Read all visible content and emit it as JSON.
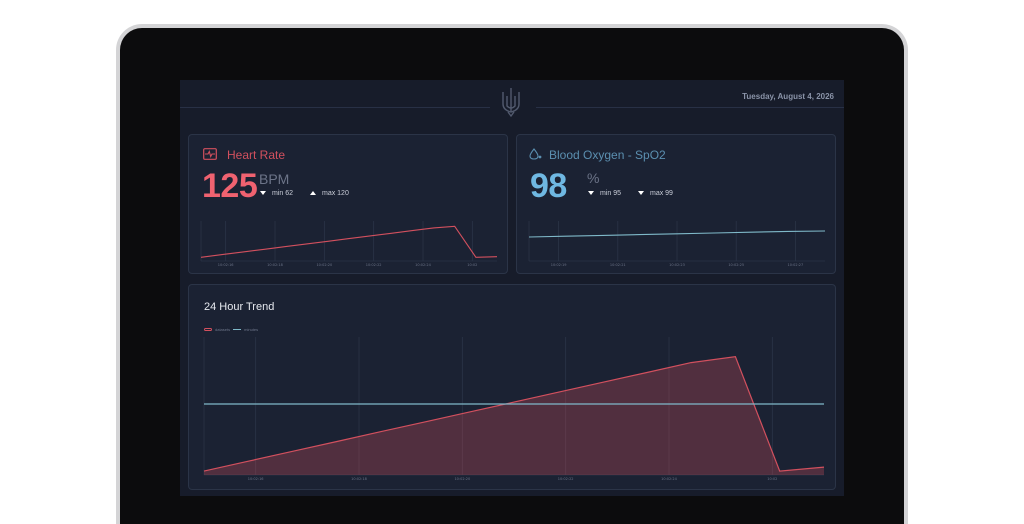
{
  "header": {
    "date": "Tuesday, August 4, 2026",
    "logo_icon": "trident-icon"
  },
  "heart_rate": {
    "title": "Heart Rate",
    "icon": "heart-monitor-icon",
    "value": "125",
    "unit": "BPM",
    "min_label": "min 62",
    "max_label": "max 120",
    "color": "#f06270",
    "x_ticks": [
      "10:02:16",
      "10:02:18",
      "10:02:20",
      "10:02:22",
      "10:02:24",
      "10:02"
    ]
  },
  "spo2": {
    "title": "Blood Oxygen - SpO2",
    "icon": "droplet-icon",
    "value": "98",
    "unit": "%",
    "min_label": "min 95",
    "max_label": "max 99",
    "color": "#6fb8e2",
    "x_ticks": [
      "10:02:19",
      "10:02:21",
      "10:02:23",
      "10:02:25",
      "10:02:27"
    ]
  },
  "trend": {
    "title": "24 Hour Trend",
    "legend": [
      {
        "label": "datasets",
        "color": "#d2505e"
      },
      {
        "label": "minutes",
        "color": "#7fb9c9"
      }
    ],
    "x_ticks": [
      "10:02:16",
      "10:02:18",
      "10:02:20",
      "10:02:22",
      "10:02:24",
      "10:02"
    ]
  },
  "chart_data": [
    {
      "type": "line",
      "series": [
        {
          "values": [
            62,
            67,
            72,
            77,
            82,
            87,
            92,
            97,
            102,
            107,
            112,
            117,
            120,
            62,
            63
          ]
        }
      ],
      "ylim": [
        55,
        130
      ],
      "color": "#d2505e"
    },
    {
      "type": "line",
      "series": [
        {
          "values": [
            96,
            96.2,
            96.4,
            96.6,
            96.8,
            97,
            97.2,
            97.4,
            97.5
          ]
        }
      ],
      "ylim": [
        90,
        100
      ],
      "color": "#7fb9c9"
    },
    {
      "type": "area",
      "series": [
        {
          "name": "datasets",
          "values": [
            62,
            67,
            72,
            77,
            82,
            87,
            92,
            97,
            102,
            107,
            112,
            117,
            120,
            62,
            64
          ]
        },
        {
          "name": "minutes",
          "values": [
            96,
            96,
            96,
            96,
            96,
            96,
            96,
            96,
            96,
            96,
            96,
            96,
            96,
            96,
            96
          ]
        }
      ],
      "ylim": [
        60,
        130
      ]
    }
  ]
}
